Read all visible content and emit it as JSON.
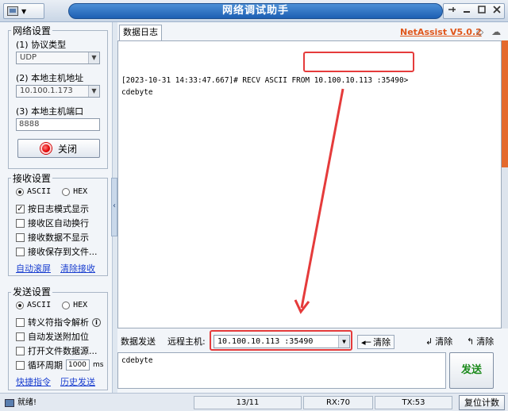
{
  "window": {
    "title": "网络调试助手",
    "min_icon": "minimize-icon",
    "max_icon": "maximize-icon",
    "close_icon": "close-icon",
    "pin_icon": "pin-icon",
    "menu_arrow": "▼"
  },
  "net_settings": {
    "title": "网络设置",
    "protocol_label": "(1) 协议类型",
    "protocol_value": "UDP",
    "host_addr_label": "(2) 本地主机地址",
    "host_addr_value": "10.100.1.173",
    "host_port_label": "(3) 本地主机端口",
    "host_port_value": "8888",
    "close_button": "关闭"
  },
  "recv_settings": {
    "title": "接收设置",
    "ascii": "ASCII",
    "hex": "HEX",
    "log_mode": "按日志模式显示",
    "auto_wrap": "接收区自动换行",
    "no_display": "接收数据不显示",
    "save_file": "接收保存到文件...",
    "auto_scroll": "自动滚屏",
    "clear_recv": "清除接收"
  },
  "send_settings": {
    "title": "发送设置",
    "ascii": "ASCII",
    "hex": "HEX",
    "escape": "转义符指令解析",
    "auto_append": "自动发送附加位",
    "open_file": "打开文件数据源...",
    "loop": "循环周期",
    "loop_value": "1000",
    "loop_unit": "ms",
    "shortcuts": "快捷指令",
    "history": "历史发送"
  },
  "main": {
    "log_tab": "数据日志",
    "brand": "NetAssist V5.0.2",
    "log_lines": [
      "[2023-10-31 14:33:47.667]# RECV ASCII FROM 10.100.10.113 :35490>",
      "cdebyte"
    ],
    "send_tab": "数据发送",
    "remote_host_label": "远程主机:",
    "remote_host_value": "10.100.10.113 :35490",
    "clear1": "清除",
    "clear2": "清除",
    "clear3": "清除",
    "send_text": "cdebyte",
    "send_button": "发送"
  },
  "status": {
    "ready": "就绪!",
    "count": "13/11",
    "rx": "RX:70",
    "tx": "TX:53",
    "reset": "复位计数"
  },
  "colors": {
    "brand": "#e0571b",
    "annotation": "#e53b3b",
    "send_green": "#1b8a1b",
    "link": "#1a3fd0"
  }
}
